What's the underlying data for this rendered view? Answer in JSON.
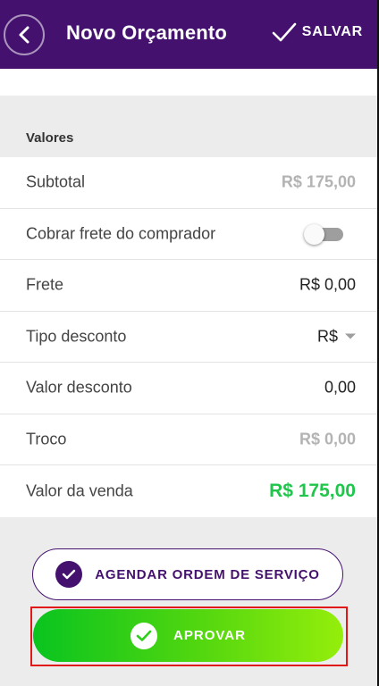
{
  "header": {
    "title": "Novo Orçamento",
    "save_label": "SALVAR",
    "bg_color": "#44126e"
  },
  "section": {
    "title": "Valores"
  },
  "rows": [
    {
      "label": "Subtotal",
      "value": "R$ 175,00"
    },
    {
      "label": "Cobrar frete do comprador",
      "toggle": false
    },
    {
      "label": "Frete",
      "value": "R$ 0,00"
    },
    {
      "label": "Tipo desconto",
      "value": "R$"
    },
    {
      "label": "Valor desconto",
      "value": "0,00"
    },
    {
      "label": "Troco",
      "value": "R$ 0,00"
    },
    {
      "label": "Valor da venda",
      "value": "R$ 175,00"
    }
  ],
  "buttons": {
    "schedule_label": "AGENDAR ORDEM DE SERVIÇO",
    "approve_label": "APROVAR"
  },
  "icons": {
    "back": "chevron-left-icon",
    "save": "check-icon",
    "schedule": "check-circle-icon",
    "approve": "check-circle-icon"
  },
  "colors": {
    "accent": "#44126e",
    "sale_value": "#1fc64b",
    "approve_gradient_start": "#09c41f",
    "approve_gradient_end": "#95ee0b",
    "highlight_frame": "#e01818"
  }
}
